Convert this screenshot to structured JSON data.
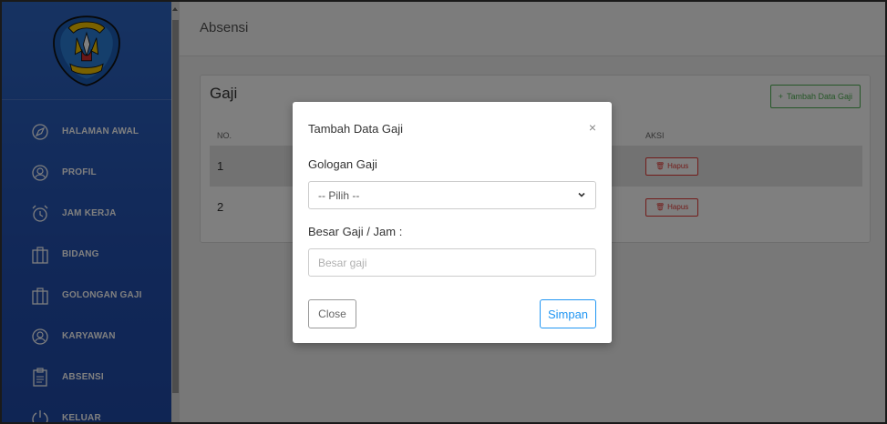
{
  "sidebar": {
    "items": [
      {
        "label": "HALAMAN AWAL",
        "icon": "compass-icon"
      },
      {
        "label": "PROFIL",
        "icon": "user-icon"
      },
      {
        "label": "JAM KERJA",
        "icon": "alarm-clock-icon"
      },
      {
        "label": "BIDANG",
        "icon": "briefcase-icon"
      },
      {
        "label": "GOLONGAN GAJI",
        "icon": "briefcase-icon"
      },
      {
        "label": "KARYAWAN",
        "icon": "user-icon"
      },
      {
        "label": "ABSENSI",
        "icon": "clipboard-icon"
      },
      {
        "label": "KELUAR",
        "icon": "power-icon"
      }
    ]
  },
  "header": {
    "title": "Absensi"
  },
  "card": {
    "title": "Gaji",
    "add_button": "Tambah Data Gaji",
    "columns": {
      "no": "NO.",
      "aksi": "AKSI"
    },
    "rows": [
      {
        "no": "1",
        "action": "Hapus"
      },
      {
        "no": "2",
        "action": "Hapus"
      }
    ]
  },
  "modal": {
    "title": "Tambah Data Gaji",
    "close_symbol": "×",
    "field1_label": "Gologan Gaji",
    "field1_selected": "-- Pilih --",
    "field2_label": "Besar Gaji / Jam :",
    "field2_placeholder": "Besar gaji",
    "field2_value": "",
    "close_button": "Close",
    "save_button": "Simpan"
  },
  "colors": {
    "sidebar": "#2d66c4",
    "success": "#4caf50",
    "danger": "#e53935",
    "primary": "#2196f3"
  }
}
